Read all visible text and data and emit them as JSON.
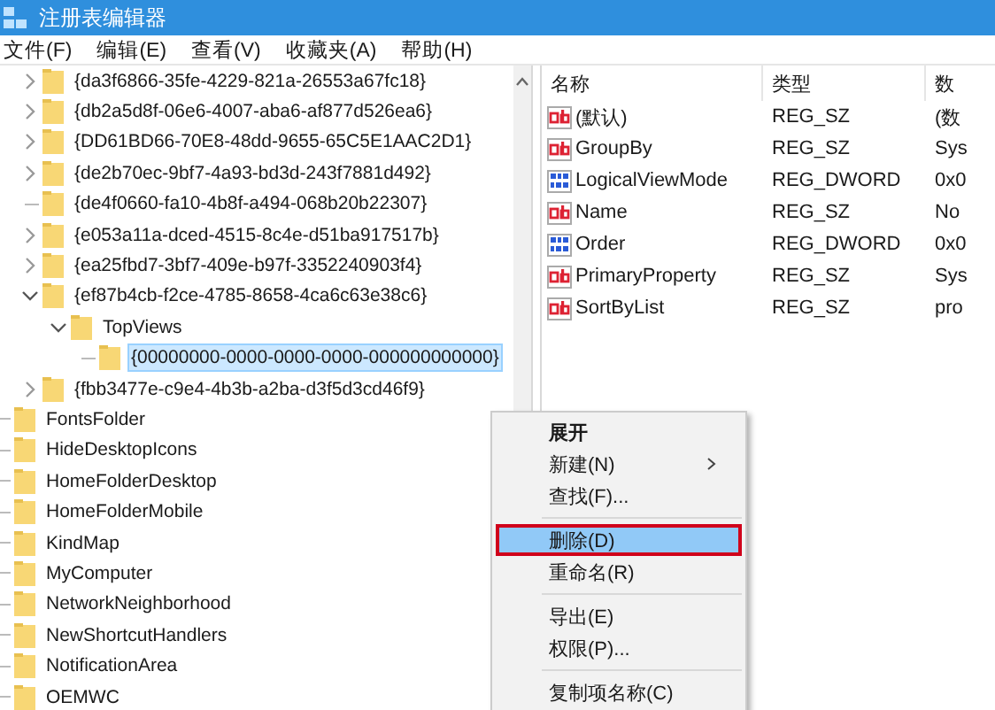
{
  "window": {
    "title": "注册表编辑器"
  },
  "menu_bar": [
    "文件(F)",
    "编辑(E)",
    "查看(V)",
    "收藏夹(A)",
    "帮助(H)"
  ],
  "tree": {
    "continued_children": [
      {
        "label": "{da3f6866-35fe-4229-821a-26553a67fc18}",
        "has_children": true,
        "expanded": false,
        "selected": false
      },
      {
        "label": "{db2a5d8f-06e6-4007-aba6-af877d526ea6}",
        "has_children": true,
        "expanded": false,
        "selected": false
      },
      {
        "label": "{DD61BD66-70E8-48dd-9655-65C5E1AAC2D1}",
        "has_children": true,
        "expanded": false,
        "selected": false
      },
      {
        "label": "{de2b70ec-9bf7-4a93-bd3d-243f7881d492}",
        "has_children": true,
        "expanded": false,
        "selected": false
      },
      {
        "label": "{de4f0660-fa10-4b8f-a494-068b20b22307}",
        "has_children": false,
        "selected": false
      },
      {
        "label": "{e053a11a-dced-4515-8c4e-d51ba917517b}",
        "has_children": true,
        "expanded": false,
        "selected": false
      },
      {
        "label": "{ea25fbd7-3bf7-409e-b97f-3352240903f4}",
        "has_children": true,
        "expanded": false,
        "selected": false
      },
      {
        "label": "{ef87b4cb-f2ce-4785-8658-4ca6c63e38c6}",
        "has_children": true,
        "expanded": true,
        "selected": false,
        "children": [
          {
            "label": "TopViews",
            "has_children": true,
            "expanded": true,
            "selected": false,
            "children": [
              {
                "label": "{00000000-0000-0000-0000-000000000000}",
                "has_children": false,
                "selected": true
              }
            ]
          }
        ]
      },
      {
        "label": "{fbb3477e-c9e4-4b3b-a2ba-d3f5d3cd46f9}",
        "has_children": true,
        "expanded": false,
        "selected": false
      }
    ],
    "items": [
      {
        "label": "FontsFolder",
        "has_children": false,
        "selected": false
      },
      {
        "label": "HideDesktopIcons",
        "has_children": false,
        "selected": false
      },
      {
        "label": "HomeFolderDesktop",
        "has_children": false,
        "selected": false
      },
      {
        "label": "HomeFolderMobile",
        "has_children": false,
        "selected": false
      },
      {
        "label": "KindMap",
        "has_children": false,
        "selected": false
      },
      {
        "label": "MyComputer",
        "has_children": false,
        "selected": false
      },
      {
        "label": "NetworkNeighborhood",
        "has_children": false,
        "selected": false
      },
      {
        "label": "NewShortcutHandlers",
        "has_children": false,
        "selected": false
      },
      {
        "label": "NotificationArea",
        "has_children": false,
        "selected": false
      },
      {
        "label": "OEMWC",
        "has_children": false,
        "selected": false
      }
    ]
  },
  "values": {
    "columns": [
      "名称",
      "类型",
      "数"
    ],
    "rows": [
      {
        "kind": "string",
        "name": "(默认)",
        "type": "REG_SZ",
        "data": "(数"
      },
      {
        "kind": "string",
        "name": "GroupBy",
        "type": "REG_SZ",
        "data": "Sys"
      },
      {
        "kind": "binary",
        "name": "LogicalViewMode",
        "type": "REG_DWORD",
        "data": "0x0"
      },
      {
        "kind": "string",
        "name": "Name",
        "type": "REG_SZ",
        "data": "No"
      },
      {
        "kind": "binary",
        "name": "Order",
        "type": "REG_DWORD",
        "data": "0x0"
      },
      {
        "kind": "string",
        "name": "PrimaryProperty",
        "type": "REG_SZ",
        "data": "Sys"
      },
      {
        "kind": "string",
        "name": "SortByList",
        "type": "REG_SZ",
        "data": "pro"
      }
    ]
  },
  "context_menu": [
    {
      "kind": "default",
      "label": "展开",
      "submenu": false,
      "selected": false,
      "annotated": false
    },
    {
      "kind": "item",
      "label": "新建(N)",
      "submenu": true,
      "selected": false,
      "annotated": false
    },
    {
      "kind": "item",
      "label": "查找(F)...",
      "submenu": false,
      "selected": false,
      "annotated": false
    },
    {
      "kind": "separator"
    },
    {
      "kind": "item",
      "label": "删除(D)",
      "submenu": false,
      "selected": true,
      "annotated": true
    },
    {
      "kind": "item",
      "label": "重命名(R)",
      "submenu": false,
      "selected": false,
      "annotated": false
    },
    {
      "kind": "separator"
    },
    {
      "kind": "item",
      "label": "导出(E)",
      "submenu": false,
      "selected": false,
      "annotated": false
    },
    {
      "kind": "item",
      "label": "权限(P)...",
      "submenu": false,
      "selected": false,
      "annotated": false
    },
    {
      "kind": "separator"
    },
    {
      "kind": "item",
      "label": "复制项名称(C)",
      "submenu": false,
      "selected": false,
      "annotated": false
    }
  ]
}
